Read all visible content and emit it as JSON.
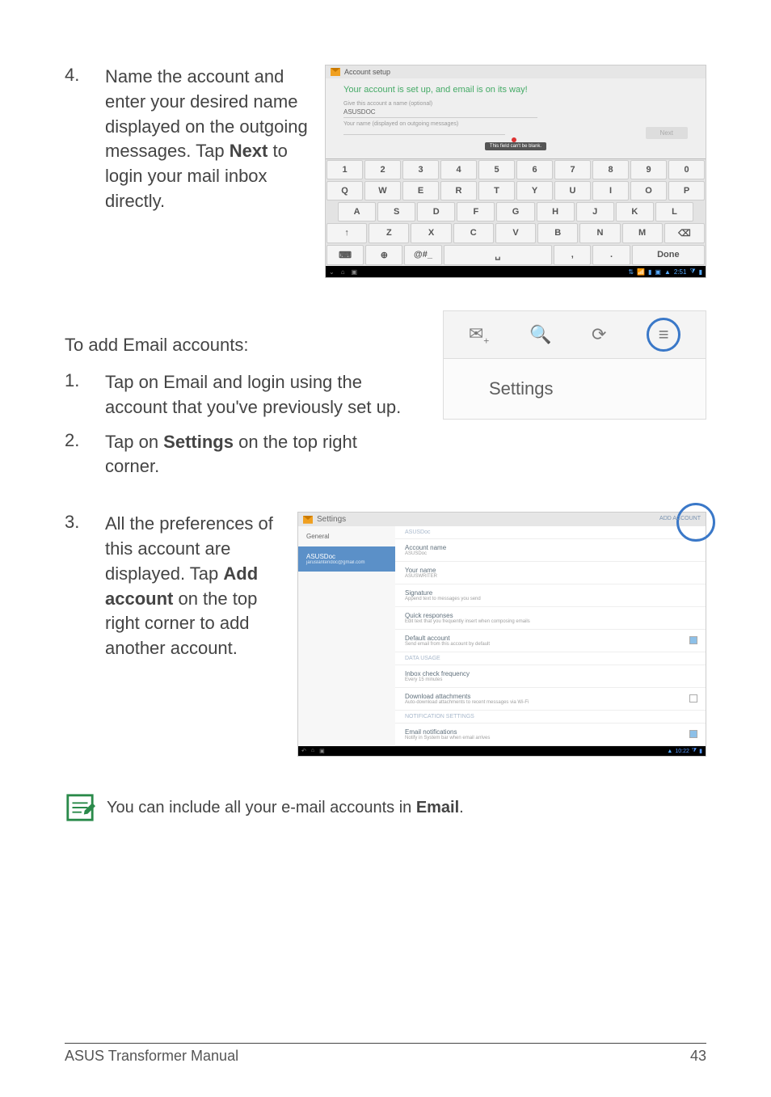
{
  "step4": {
    "num": "4.",
    "text_pre": "Name the account and enter your desired name displayed on the outgoing messages. Tap ",
    "text_bold": "Next",
    "text_post": " to login your mail inbox directly."
  },
  "setup_shot": {
    "window_title": "Account setup",
    "heading": "Your account is set up, and email is on its way!",
    "label1": "Give this account a name (optional)",
    "value1": "ASUSDOC",
    "label2": "Your name (displayed on outgoing messages)",
    "field_error": "This field can't be blank.",
    "next_btn": "Next",
    "keyboard": {
      "row1": [
        "1",
        "2",
        "3",
        "4",
        "5",
        "6",
        "7",
        "8",
        "9",
        "0"
      ],
      "row2": [
        "Q",
        "W",
        "E",
        "R",
        "T",
        "Y",
        "U",
        "I",
        "O",
        "P"
      ],
      "row3": [
        "A",
        "S",
        "D",
        "F",
        "G",
        "H",
        "J",
        "K",
        "L"
      ],
      "row4": [
        "↑",
        "Z",
        "X",
        "C",
        "V",
        "B",
        "N",
        "M",
        "⌫"
      ],
      "row5_left": "⌨",
      "row5_globe": "⊕",
      "row5_sym": "@#_",
      "row5_space": "␣",
      "row5_comma": ",",
      "row5_period": ".",
      "row5_done": "Done"
    },
    "status_time": "2:51",
    "status_warn": "▲"
  },
  "subtitle_add": "To add Email accounts:",
  "step1_add": {
    "num": "1.",
    "text": "Tap on Email and login using the account that you've previously set up."
  },
  "step2_add": {
    "num": "2.",
    "text_pre": "Tap on ",
    "text_bold": "Settings",
    "text_post": " on the top right corner."
  },
  "menu_shot": {
    "icon_mail": "✉",
    "icon_search": "🔍",
    "icon_refresh": "⟳",
    "icon_menu": "≡",
    "label": "Settings"
  },
  "step3_add": {
    "num": "3.",
    "text_pre": "All the preferences of this account are displayed. Tap ",
    "text_bold": "Add account",
    "text_post": " on the top right corner to add another account."
  },
  "settings_shot": {
    "title": "Settings",
    "add_account": "ADD ACCOUNT",
    "left_general": "General",
    "left_active_name": "ASUSDoc",
    "left_active_email": "jaruslantendoc@gmail.com",
    "right_header": "ASUSDoc",
    "items": [
      {
        "t": "Account name",
        "s": "ASUSDoc"
      },
      {
        "t": "Your name",
        "s": "ASUSWRITER"
      },
      {
        "t": "Signature",
        "s": "Append text to messages you send"
      },
      {
        "t": "Quick responses",
        "s": "Edit text that you frequently insert when composing emails"
      },
      {
        "t": "Default account",
        "s": "Send email from this account by default",
        "chk": "on"
      }
    ],
    "sec_data": "DATA USAGE",
    "data_items": [
      {
        "t": "Inbox check frequency",
        "s": "Every 15 minutes"
      },
      {
        "t": "Download attachments",
        "s": "Auto-download attachments to recent messages via Wi-Fi",
        "chk": "off"
      }
    ],
    "sec_notif": "NOTIFICATION SETTINGS",
    "notif_items": [
      {
        "t": "Email notifications",
        "s": "Notify in System bar when email arrives",
        "chk": "on"
      }
    ],
    "status_time": "10:22"
  },
  "note": {
    "text_pre": "You can include all your e-mail accounts in ",
    "text_bold": "Email",
    "text_post": "."
  },
  "footer": {
    "left": "ASUS Transformer Manual",
    "right": "43"
  }
}
